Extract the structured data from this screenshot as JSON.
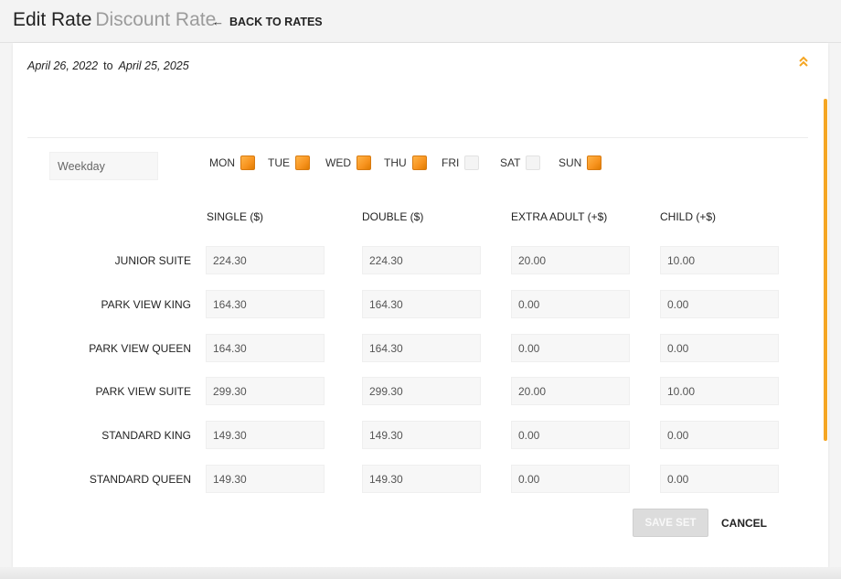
{
  "header": {
    "title": "Edit Rate",
    "subtitle": "Discount Rate",
    "back_label": "BACK TO RATES"
  },
  "date_range": {
    "start": "April 26, 2022",
    "connector": "to",
    "end": "April 25, 2025"
  },
  "set_name": {
    "value": "Weekday"
  },
  "days": [
    {
      "label": "MON",
      "checked": true
    },
    {
      "label": "TUE",
      "checked": true
    },
    {
      "label": "WED",
      "checked": true
    },
    {
      "label": "THU",
      "checked": true
    },
    {
      "label": "FRI",
      "checked": false
    },
    {
      "label": "SAT",
      "checked": false
    },
    {
      "label": "SUN",
      "checked": true
    }
  ],
  "columns": [
    "SINGLE ($)",
    "DOUBLE ($)",
    "EXTRA ADULT (+$)",
    "CHILD (+$)"
  ],
  "rooms": [
    {
      "name": "JUNIOR SUITE",
      "single": "224.30",
      "double": "224.30",
      "extra_adult": "20.00",
      "child": "10.00"
    },
    {
      "name": "PARK VIEW KING",
      "single": "164.30",
      "double": "164.30",
      "extra_adult": "0.00",
      "child": "0.00"
    },
    {
      "name": "PARK VIEW QUEEN",
      "single": "164.30",
      "double": "164.30",
      "extra_adult": "0.00",
      "child": "0.00"
    },
    {
      "name": "PARK VIEW SUITE",
      "single": "299.30",
      "double": "299.30",
      "extra_adult": "20.00",
      "child": "10.00"
    },
    {
      "name": "STANDARD KING",
      "single": "149.30",
      "double": "149.30",
      "extra_adult": "0.00",
      "child": "0.00"
    },
    {
      "name": "STANDARD QUEEN",
      "single": "149.30",
      "double": "149.30",
      "extra_adult": "0.00",
      "child": "0.00"
    }
  ],
  "actions": {
    "save_label": "SAVE SET",
    "cancel_label": "CANCEL"
  },
  "colors": {
    "accent": "#f5a623",
    "checkbox_on": "#f7931e"
  },
  "icons": {
    "back": "arrow-left-icon",
    "collapse": "chevron-double-up-icon"
  }
}
